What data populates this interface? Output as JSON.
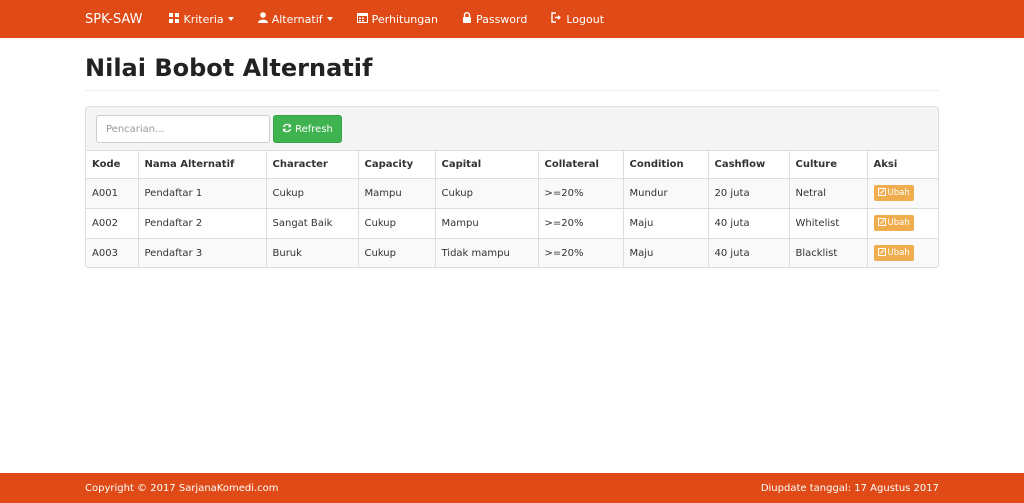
{
  "navbar": {
    "brand": "SPK-SAW",
    "items": [
      {
        "label": "Kriteria",
        "icon": "grid-icon",
        "dropdown": true
      },
      {
        "label": "Alternatif",
        "icon": "user-icon",
        "dropdown": true
      },
      {
        "label": "Perhitungan",
        "icon": "calendar-icon",
        "dropdown": false
      },
      {
        "label": "Password",
        "icon": "lock-icon",
        "dropdown": false
      },
      {
        "label": "Logout",
        "icon": "logout-icon",
        "dropdown": false
      }
    ]
  },
  "page": {
    "title": "Nilai Bobot Alternatif"
  },
  "toolbar": {
    "search_placeholder": "Pencarian...",
    "refresh_label": "Refresh"
  },
  "table": {
    "headers": [
      "Kode",
      "Nama Alternatif",
      "Character",
      "Capacity",
      "Capital",
      "Collateral",
      "Condition",
      "Cashflow",
      "Culture",
      "Aksi"
    ],
    "rows": [
      [
        "A001",
        "Pendaftar 1",
        "Cukup",
        "Mampu",
        "Cukup",
        ">=20%",
        "Mundur",
        "20 juta",
        "Netral"
      ],
      [
        "A002",
        "Pendaftar 2",
        "Sangat Baik",
        "Cukup",
        "Mampu",
        ">=20%",
        "Maju",
        "40 juta",
        "Whitelist"
      ],
      [
        "A003",
        "Pendaftar 3",
        "Buruk",
        "Cukup",
        "Tidak mampu",
        ">=20%",
        "Maju",
        "40 juta",
        "Blacklist"
      ]
    ],
    "action_label": "Ubah"
  },
  "footer": {
    "left": "Copyright © 2017 SarjanaKomedi.com",
    "right": "Diupdate tanggal: 17 Agustus 2017"
  },
  "colors": {
    "primary": "#df4a16",
    "success": "#3fb34f",
    "warning": "#f0ad4e"
  }
}
